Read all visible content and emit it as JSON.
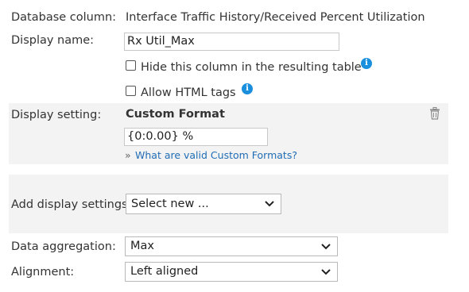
{
  "database_column": {
    "label": "Database column:",
    "value": "Interface Traffic History/Received Percent Utilization"
  },
  "display_name": {
    "label": "Display name:",
    "value": "Rx Util_Max"
  },
  "options": {
    "hide_column": {
      "label": "Hide this column in the resulting table",
      "checked": false
    },
    "allow_html": {
      "label": "Allow HTML tags",
      "checked": false
    }
  },
  "display_setting": {
    "label": "Display setting:",
    "title": "Custom Format",
    "format_value": "{0:0.00} %",
    "help_bullet": "»",
    "help_link": "What are valid Custom Formats?"
  },
  "add_display_settings": {
    "label": "Add display settings:",
    "selected": "Select new ..."
  },
  "data_aggregation": {
    "label": "Data aggregation:",
    "selected": "Max"
  },
  "alignment": {
    "label": "Alignment:",
    "selected": "Left aligned"
  },
  "colors": {
    "info_icon": "#1a8fdd",
    "link": "#1f6db5",
    "section_band": "#f3f3f3"
  }
}
